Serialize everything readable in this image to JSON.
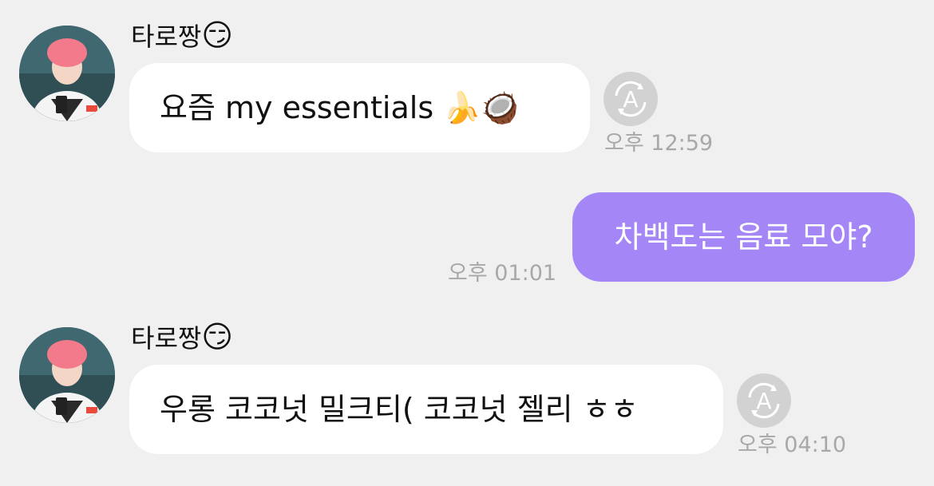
{
  "messages": [
    {
      "sender": "타로짱",
      "sender_emoji": "😏",
      "text": "요즘 my essentials 🍌🥥",
      "time": "오후 12:59",
      "translate_label": "A"
    },
    {
      "text": "차백도는 음료 모야?",
      "time": "오후 01:01"
    },
    {
      "sender": "타로짱",
      "sender_emoji": "😏",
      "text": "우롱 코코넛 밀크티( 코코넛 젤리 ㅎㅎ",
      "time": "오후 04:10",
      "translate_label": "A"
    }
  ],
  "colors": {
    "background": "#f0f0f0",
    "incoming_bubble": "#ffffff",
    "outgoing_bubble": "#a486f7",
    "timestamp": "#a8a8a8"
  }
}
